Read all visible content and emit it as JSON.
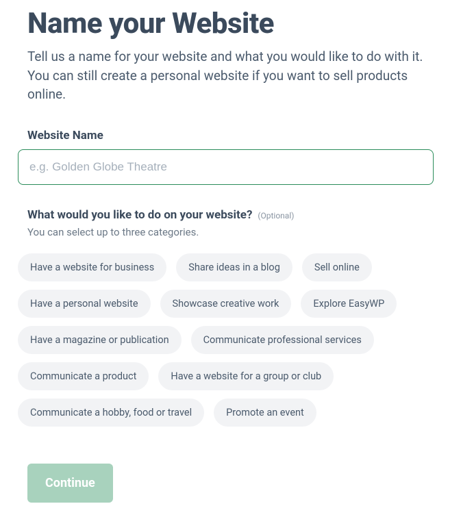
{
  "heading": "Name your Website",
  "subtitle": "Tell us a name for your website and what you would like to do with it. You can still create a personal website if you want to sell products online.",
  "websiteName": {
    "label": "Website Name",
    "placeholder": "e.g. Golden Globe Theatre",
    "value": ""
  },
  "categories": {
    "question": "What would you like to do on your website?",
    "optional_label": "(Optional)",
    "hint": "You can select up to three categories.",
    "options": [
      "Have a website for business",
      "Share ideas in a blog",
      "Sell online",
      "Have a personal website",
      "Showcase creative work",
      "Explore EasyWP",
      "Have a magazine or publication",
      "Communicate professional services",
      "Communicate a product",
      "Have a website for a group or club",
      "Communicate a hobby, food or travel",
      "Promote an event"
    ]
  },
  "buttons": {
    "continue": "Continue"
  }
}
